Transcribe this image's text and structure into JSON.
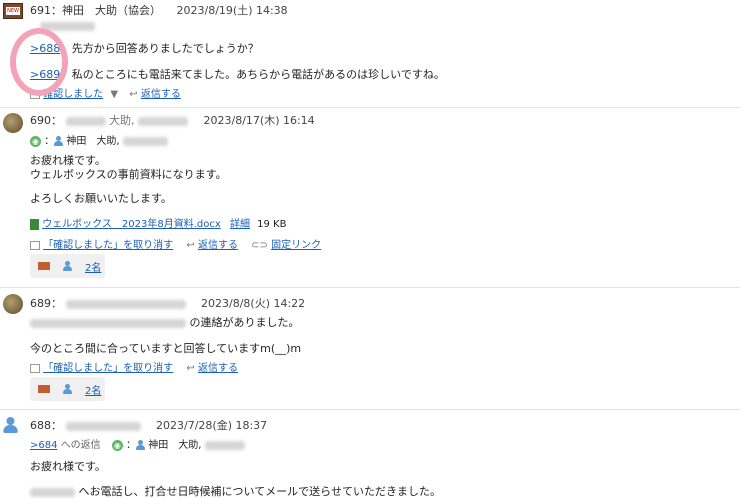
{
  "posts": [
    {
      "header": "691：神田　大助（協会）",
      "date": "2023/8/19(土) 14:38",
      "lines": [
        {
          "ref": ">688",
          "text": "先方から回答ありましたでしょうか？"
        },
        {
          "ref": ">689",
          "text": "私のところにも電話来てました。あちらから電話があるのは珍しいですね。"
        }
      ],
      "actions": {
        "confirm": "確認しました",
        "reply": "返信する"
      }
    },
    {
      "num": "690：",
      "name_visible": "大助,",
      "date": "2023/8/17(木) 16:14",
      "recipient": "神田　大助,",
      "body": [
        "お疲れ様です。",
        "ウェルボックスの事前資料になります。",
        "よろしくお願いいたします。"
      ],
      "attachment": {
        "name": "ウェルボックス　2023年8月資料.docx",
        "detail": "詳細",
        "size": "19 KB"
      },
      "actions": {
        "cancel": "「確認しました」を取り消す",
        "reply": "返信する",
        "permalink": "固定リンク"
      },
      "react_count": "2名"
    },
    {
      "num": "689：",
      "date": "2023/8/8(火) 14:22",
      "body_line1_tail": "の連絡がありました。",
      "body_line2": "今のところ間に合っていますと回答していますm(__)m",
      "actions": {
        "cancel": "「確認しました」を取り消す",
        "reply": "返信する"
      },
      "react_count": "2名"
    },
    {
      "num": "688：",
      "date": "2023/7/28(金) 18:37",
      "reply_ref": ">684",
      "reply_suffix": "への返信",
      "recipient": "神田　大助,",
      "body1": "お疲れ様です。",
      "body2_tail": "へお電話し、打合せ日時候補についてメールで送らせていただきました。"
    }
  ],
  "colors": {
    "link": "#1a5fb4",
    "highlight_circle": "#f3a3b8",
    "green": "#5cb85c"
  }
}
